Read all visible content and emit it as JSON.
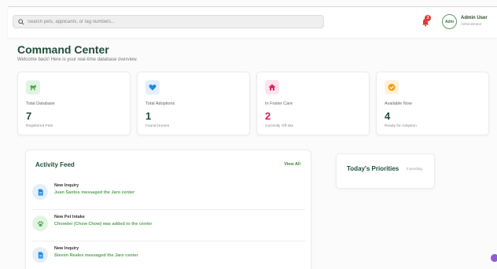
{
  "search": {
    "placeholder": "Search pets, applicants, or tag numbers..."
  },
  "notifications": {
    "count": "3"
  },
  "user": {
    "avatar_text": "Adm",
    "name": "Admin User",
    "role": "Administrator"
  },
  "header": {
    "title": "Command Center",
    "subtitle": "Welcome back! Here is your real-time database overview."
  },
  "stats": [
    {
      "label": "Total Database",
      "value": "7",
      "sub": "Registered Pets",
      "icon": "dog-icon",
      "icon_bg": "#e3f3e3",
      "icon_color": "#4caf50",
      "value_color": "#1f4f3a"
    },
    {
      "label": "Total Adoptions",
      "value": "1",
      "sub": "Found Homes",
      "icon": "heart-icon",
      "icon_bg": "#e3effc",
      "icon_color": "#1e88e5",
      "value_color": "#1f4f3a"
    },
    {
      "label": "In Foster Care",
      "value": "2",
      "sub": "Currently Off-site",
      "icon": "home-icon",
      "icon_bg": "#fde4ea",
      "icon_color": "#e91e63",
      "value_color": "#d81b60"
    },
    {
      "label": "Available Now",
      "value": "4",
      "sub": "Ready for Adoption",
      "icon": "check-icon",
      "icon_bg": "#fff1dc",
      "icon_color": "#f59e0b",
      "value_color": "#1f4f3a"
    }
  ],
  "activity": {
    "title": "Activity Feed",
    "view_all": "View All",
    "items": [
      {
        "title": "New Inquiry",
        "desc": "Juan Santos messaged the Jaro center",
        "icon": "document-icon",
        "icon_bg": "#e3effc",
        "icon_color": "#1e88e5"
      },
      {
        "title": "New Pet Intake",
        "desc": "Chowder (Chow Chow) was added to the center",
        "icon": "paw-icon",
        "icon_bg": "#e3f3e3",
        "icon_color": "#4caf50"
      },
      {
        "title": "New Inquiry",
        "desc": "Steven Reales messaged the Jaro center",
        "icon": "document-icon",
        "icon_bg": "#e3effc",
        "icon_color": "#1e88e5"
      }
    ]
  },
  "priorities": {
    "title": "Today's Priorities",
    "pending": "0 pending"
  }
}
